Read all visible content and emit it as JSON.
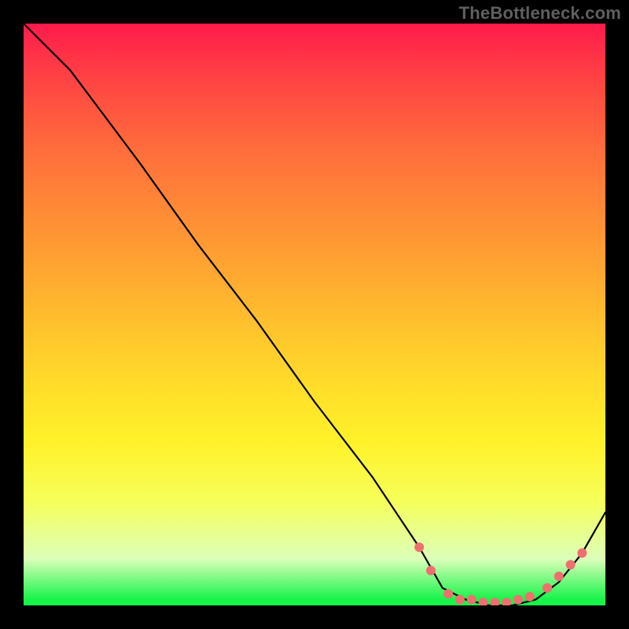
{
  "watermark": "TheBottleneck.com",
  "chart_data": {
    "type": "line",
    "title": "",
    "xlabel": "",
    "ylabel": "",
    "xlim": [
      0,
      100
    ],
    "ylim": [
      0,
      100
    ],
    "note": "Axes are unlabeled; values are normalized 0–100 estimates read off the plot area. The curve depicts a bottleneck cost that falls from top-left, reaches ~0 in a flat trough around x≈73–88, then rises toward the right edge. Dot markers highlight the near-optimal zone.",
    "series": [
      {
        "name": "curve",
        "x": [
          0,
          8,
          20,
          30,
          40,
          50,
          60,
          68,
          72,
          76,
          80,
          84,
          88,
          92,
          96,
          100
        ],
        "y": [
          100,
          92,
          76,
          62,
          49,
          35,
          22,
          10,
          3,
          1,
          0,
          0,
          1,
          4,
          9,
          16
        ]
      }
    ],
    "markers": {
      "name": "optimal-zone-dots",
      "color": "#ef6f6f",
      "points": [
        {
          "x": 68,
          "y": 10
        },
        {
          "x": 70,
          "y": 6
        },
        {
          "x": 73,
          "y": 2
        },
        {
          "x": 75,
          "y": 1
        },
        {
          "x": 77,
          "y": 1
        },
        {
          "x": 79,
          "y": 0.5
        },
        {
          "x": 81,
          "y": 0.5
        },
        {
          "x": 83,
          "y": 0.5
        },
        {
          "x": 85,
          "y": 1
        },
        {
          "x": 87,
          "y": 1.5
        },
        {
          "x": 90,
          "y": 3
        },
        {
          "x": 92,
          "y": 5
        },
        {
          "x": 94,
          "y": 7
        },
        {
          "x": 96,
          "y": 9
        }
      ]
    }
  }
}
